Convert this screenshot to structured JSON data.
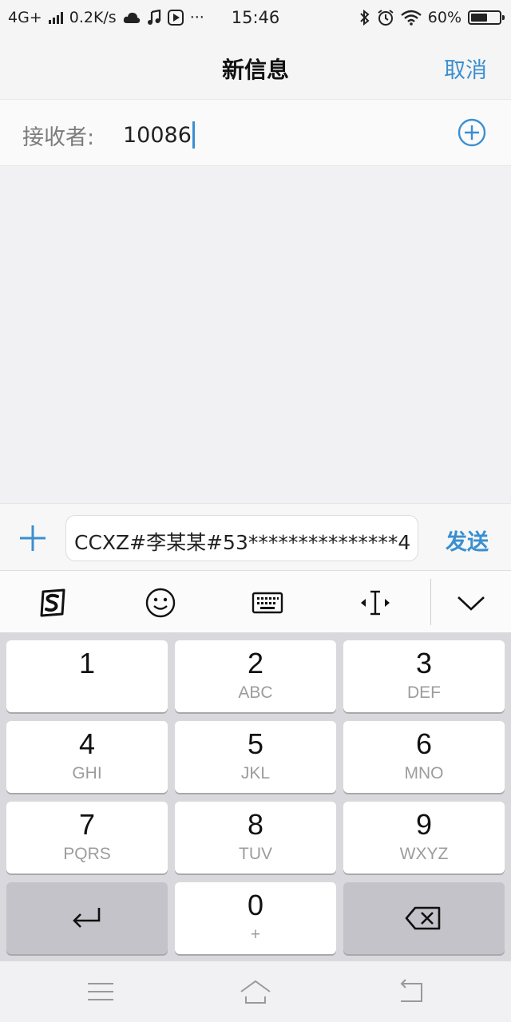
{
  "status_bar": {
    "network": "4G+",
    "speed": "0.2K/s",
    "more": "···",
    "time": "15:46",
    "battery": "60%",
    "battery_level": 0.6
  },
  "header": {
    "title": "新信息",
    "cancel_label": "取消"
  },
  "recipient": {
    "label": "接收者:",
    "value": "10086"
  },
  "compose": {
    "message": "CCXZ#李某某#53***************4",
    "send_label": "发送"
  },
  "keyboard": {
    "keys": [
      {
        "digit": "1",
        "letters": ""
      },
      {
        "digit": "2",
        "letters": "ABC"
      },
      {
        "digit": "3",
        "letters": "DEF"
      },
      {
        "digit": "4",
        "letters": "GHI"
      },
      {
        "digit": "5",
        "letters": "JKL"
      },
      {
        "digit": "6",
        "letters": "MNO"
      },
      {
        "digit": "7",
        "letters": "PQRS"
      },
      {
        "digit": "8",
        "letters": "TUV"
      },
      {
        "digit": "9",
        "letters": "WXYZ"
      },
      {
        "digit": "0",
        "letters": "+"
      }
    ]
  },
  "colors": {
    "accent": "#3a8fd1",
    "background": "#f1f1f3",
    "keypad": "#d9d9dd"
  }
}
